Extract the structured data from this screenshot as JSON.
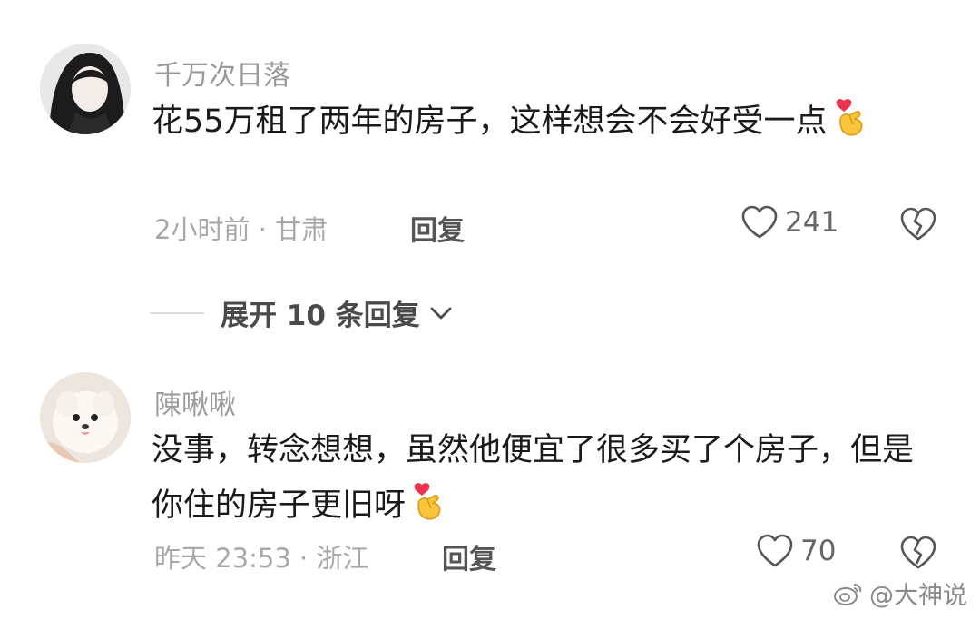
{
  "comments": [
    {
      "username": "千万次日落",
      "text": "花55万租了两年的房子，这样想会不会好受一点",
      "emoji_icon": "finger-heart-emoji",
      "meta": "2小时前 · 甘肃",
      "reply_label": "回复",
      "like_count": "241",
      "expand_label": "展开 10 条回复"
    },
    {
      "username": "陳啾啾",
      "text": "没事，转念想想，虽然他便宜了很多买了个房子，但是你住的房子更旧呀",
      "emoji_icon": "finger-heart-emoji",
      "meta": "昨天 23:53 · 浙江",
      "reply_label": "回复",
      "like_count": "70"
    }
  ],
  "watermark": {
    "text": "@大神说",
    "icon": "weibo-icon"
  },
  "colors": {
    "background": "#ffffff",
    "username": "#9a9a9a",
    "body_text": "#1a1a1a",
    "meta": "#a8a8a8"
  }
}
